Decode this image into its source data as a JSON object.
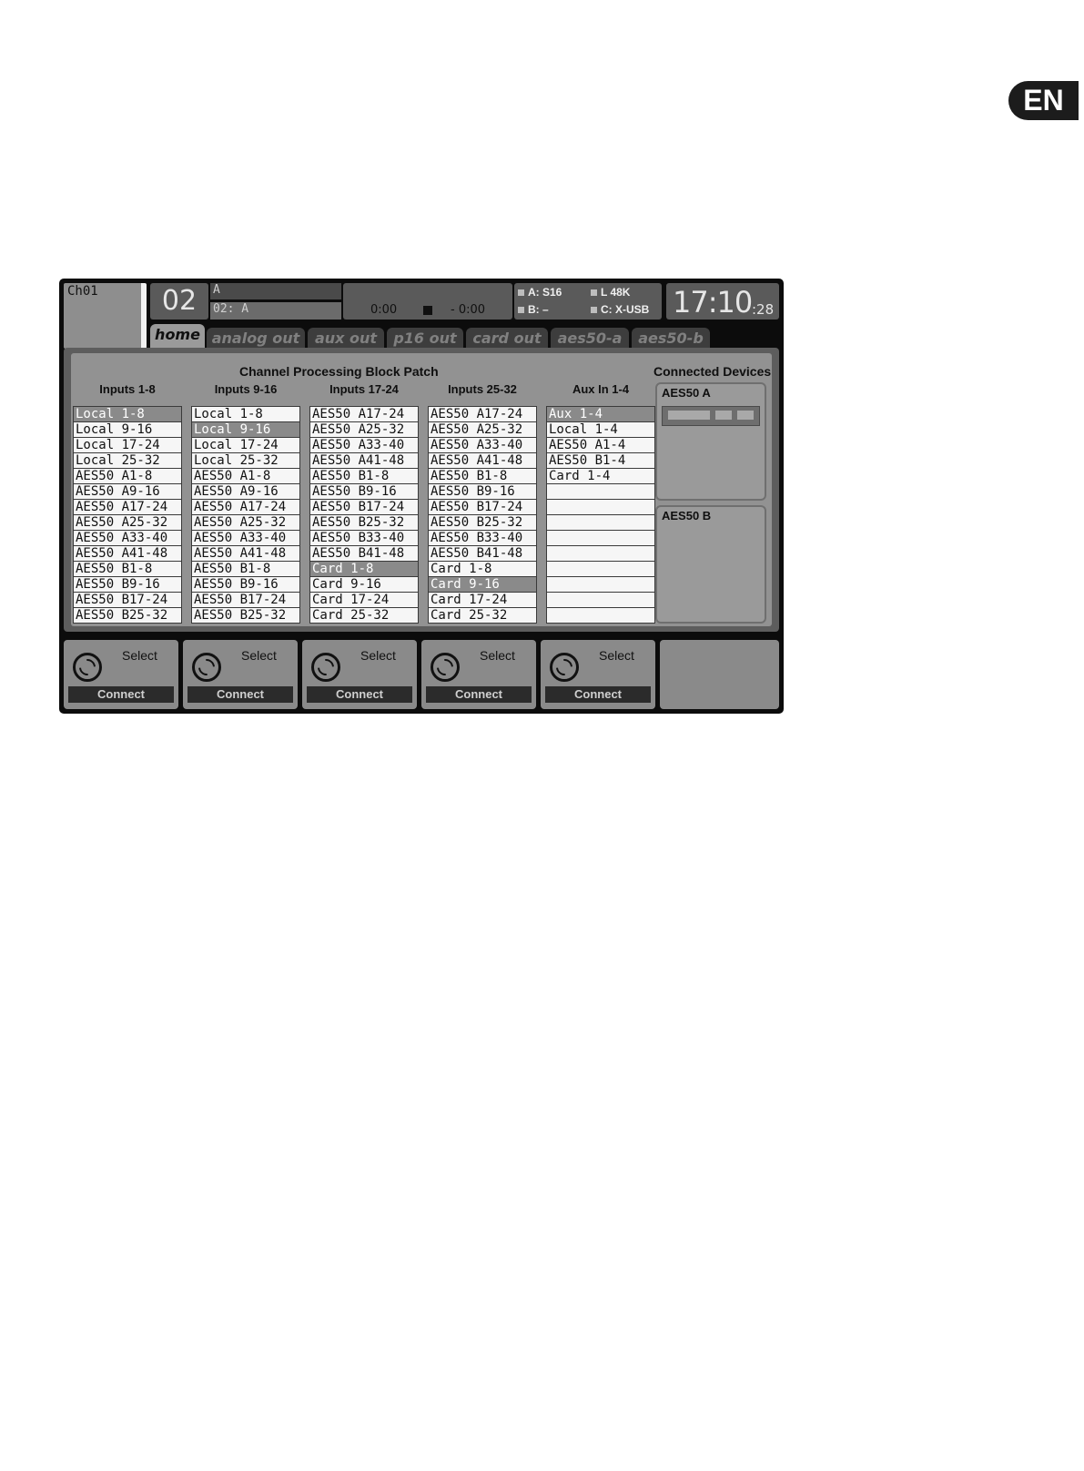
{
  "lang_badge": "EN",
  "header": {
    "channel": "Ch01",
    "scene_number": "02",
    "scene_name": "A",
    "scene_label": "02: A",
    "transport_elapsed": "0:00",
    "transport_remaining": "- 0:00",
    "status_a": "A: S16",
    "status_b": "B:  –",
    "status_rate": "L  48K",
    "status_card": "C: X-USB",
    "clock_hm": "17:10",
    "clock_sec": ":28"
  },
  "tabs": [
    "home",
    "analog out",
    "aux out",
    "p16 out",
    "card out",
    "aes50-a",
    "aes50-b"
  ],
  "active_tab": "home",
  "patch": {
    "title": "Channel Processing Block Patch",
    "columns": [
      {
        "header": "Inputs 1-8",
        "selected": 0,
        "items": [
          "Local 1-8",
          "Local 9-16",
          "Local 17-24",
          "Local 25-32",
          "AES50 A1-8",
          "AES50 A9-16",
          "AES50 A17-24",
          "AES50 A25-32",
          "AES50 A33-40",
          "AES50 A41-48",
          "AES50 B1-8",
          "AES50 B9-16",
          "AES50 B17-24",
          "AES50 B25-32"
        ]
      },
      {
        "header": "Inputs 9-16",
        "selected": 1,
        "items": [
          "Local 1-8",
          "Local 9-16",
          "Local 17-24",
          "Local 25-32",
          "AES50 A1-8",
          "AES50 A9-16",
          "AES50 A17-24",
          "AES50 A25-32",
          "AES50 A33-40",
          "AES50 A41-48",
          "AES50 B1-8",
          "AES50 B9-16",
          "AES50 B17-24",
          "AES50 B25-32"
        ]
      },
      {
        "header": "Inputs 17-24",
        "selected": 10,
        "items": [
          "AES50 A17-24",
          "AES50 A25-32",
          "AES50 A33-40",
          "AES50 A41-48",
          "AES50 B1-8",
          "AES50 B9-16",
          "AES50 B17-24",
          "AES50 B25-32",
          "AES50 B33-40",
          "AES50 B41-48",
          "Card 1-8",
          "Card 9-16",
          "Card 17-24",
          "Card 25-32"
        ]
      },
      {
        "header": "Inputs 25-32",
        "selected": 11,
        "items": [
          "AES50 A17-24",
          "AES50 A25-32",
          "AES50 A33-40",
          "AES50 A41-48",
          "AES50 B1-8",
          "AES50 B9-16",
          "AES50 B17-24",
          "AES50 B25-32",
          "AES50 B33-40",
          "AES50 B41-48",
          "Card 1-8",
          "Card 9-16",
          "Card 17-24",
          "Card 25-32"
        ]
      },
      {
        "header": "Aux In 1-4",
        "selected": 0,
        "items": [
          "Aux 1-4",
          "Local 1-4",
          "AES50 A1-4",
          "AES50 B1-4",
          "Card 1-4",
          "",
          "",
          "",
          "",
          "",
          "",
          "",
          "",
          ""
        ]
      }
    ]
  },
  "connected_devices": {
    "title": "Connected Devices",
    "devices": [
      "AES50 A",
      "AES50 B"
    ]
  },
  "encoders": [
    {
      "top_label": "Select",
      "bottom_label": "Connect"
    },
    {
      "top_label": "Select",
      "bottom_label": "Connect"
    },
    {
      "top_label": "Select",
      "bottom_label": "Connect"
    },
    {
      "top_label": "Select",
      "bottom_label": "Connect"
    },
    {
      "top_label": "Select",
      "bottom_label": "Connect"
    }
  ]
}
